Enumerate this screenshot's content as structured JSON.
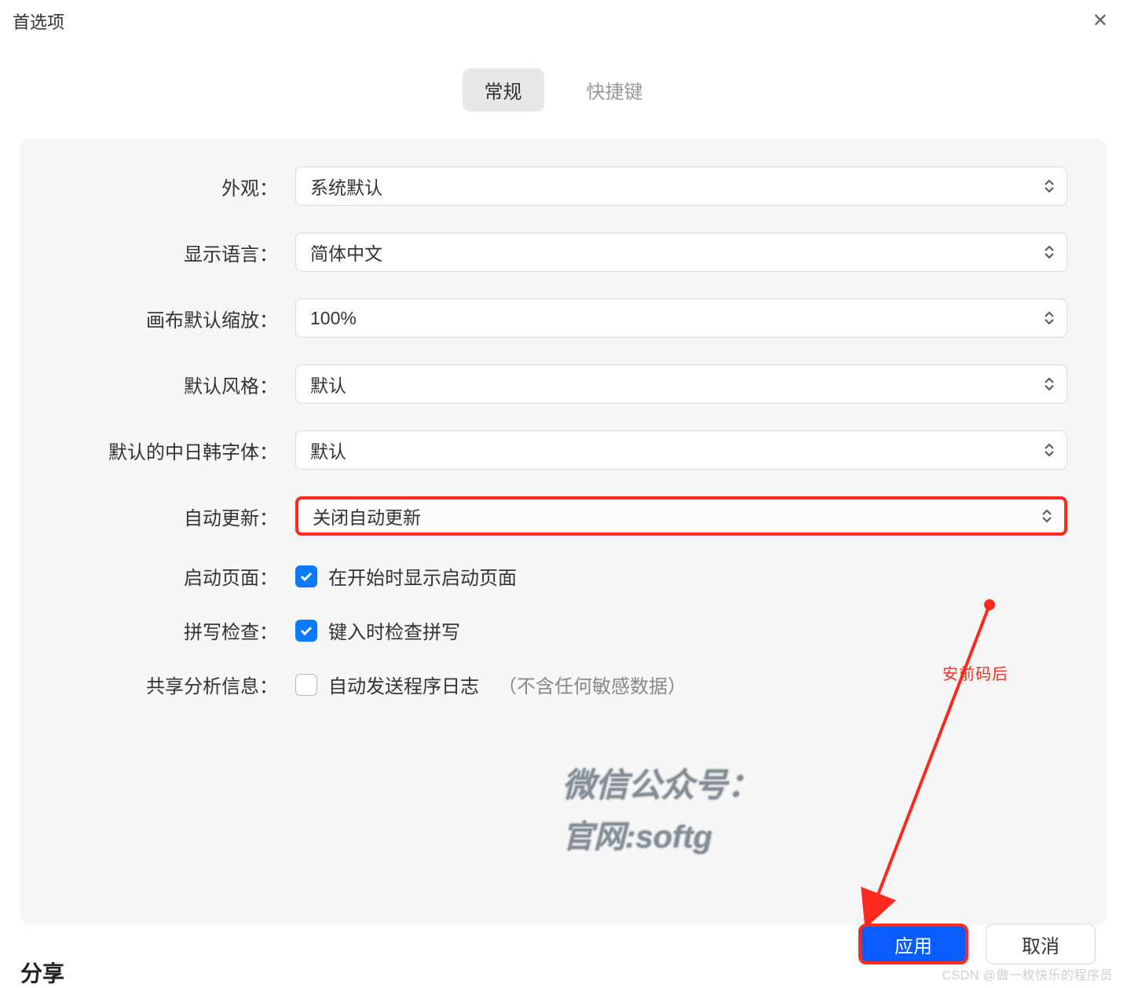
{
  "dialog": {
    "title": "首选项"
  },
  "tabs": [
    {
      "label": "常规",
      "active": true
    },
    {
      "label": "快捷键",
      "active": false
    }
  ],
  "form": {
    "appearance": {
      "label": "外观：",
      "value": "系统默认"
    },
    "language": {
      "label": "显示语言：",
      "value": "简体中文"
    },
    "canvas_zoom": {
      "label": "画布默认缩放：",
      "value": "100%"
    },
    "default_style": {
      "label": "默认风格：",
      "value": "默认"
    },
    "cjk_font": {
      "label": "默认的中日韩字体：",
      "value": "默认"
    },
    "auto_update": {
      "label": "自动更新：",
      "value": "关闭自动更新"
    },
    "startup": {
      "label": "启动页面：",
      "checked": true,
      "text": "在开始时显示启动页面"
    },
    "spellcheck": {
      "label": "拼写检查：",
      "checked": true,
      "text": "键入时检查拼写"
    },
    "analytics": {
      "label": "共享分析信息：",
      "checked": false,
      "text": "自动发送程序日志",
      "note": "（不含任何敏感数据）"
    }
  },
  "section": {
    "title": "分享"
  },
  "footer": {
    "apply": "应用",
    "cancel": "取消"
  },
  "annotation": {
    "label": "安前码后"
  },
  "watermark": {
    "line1": "微信公众号：",
    "line2": "官网:softg",
    "csdn": "CSDN @做一枚快乐的程序员"
  }
}
